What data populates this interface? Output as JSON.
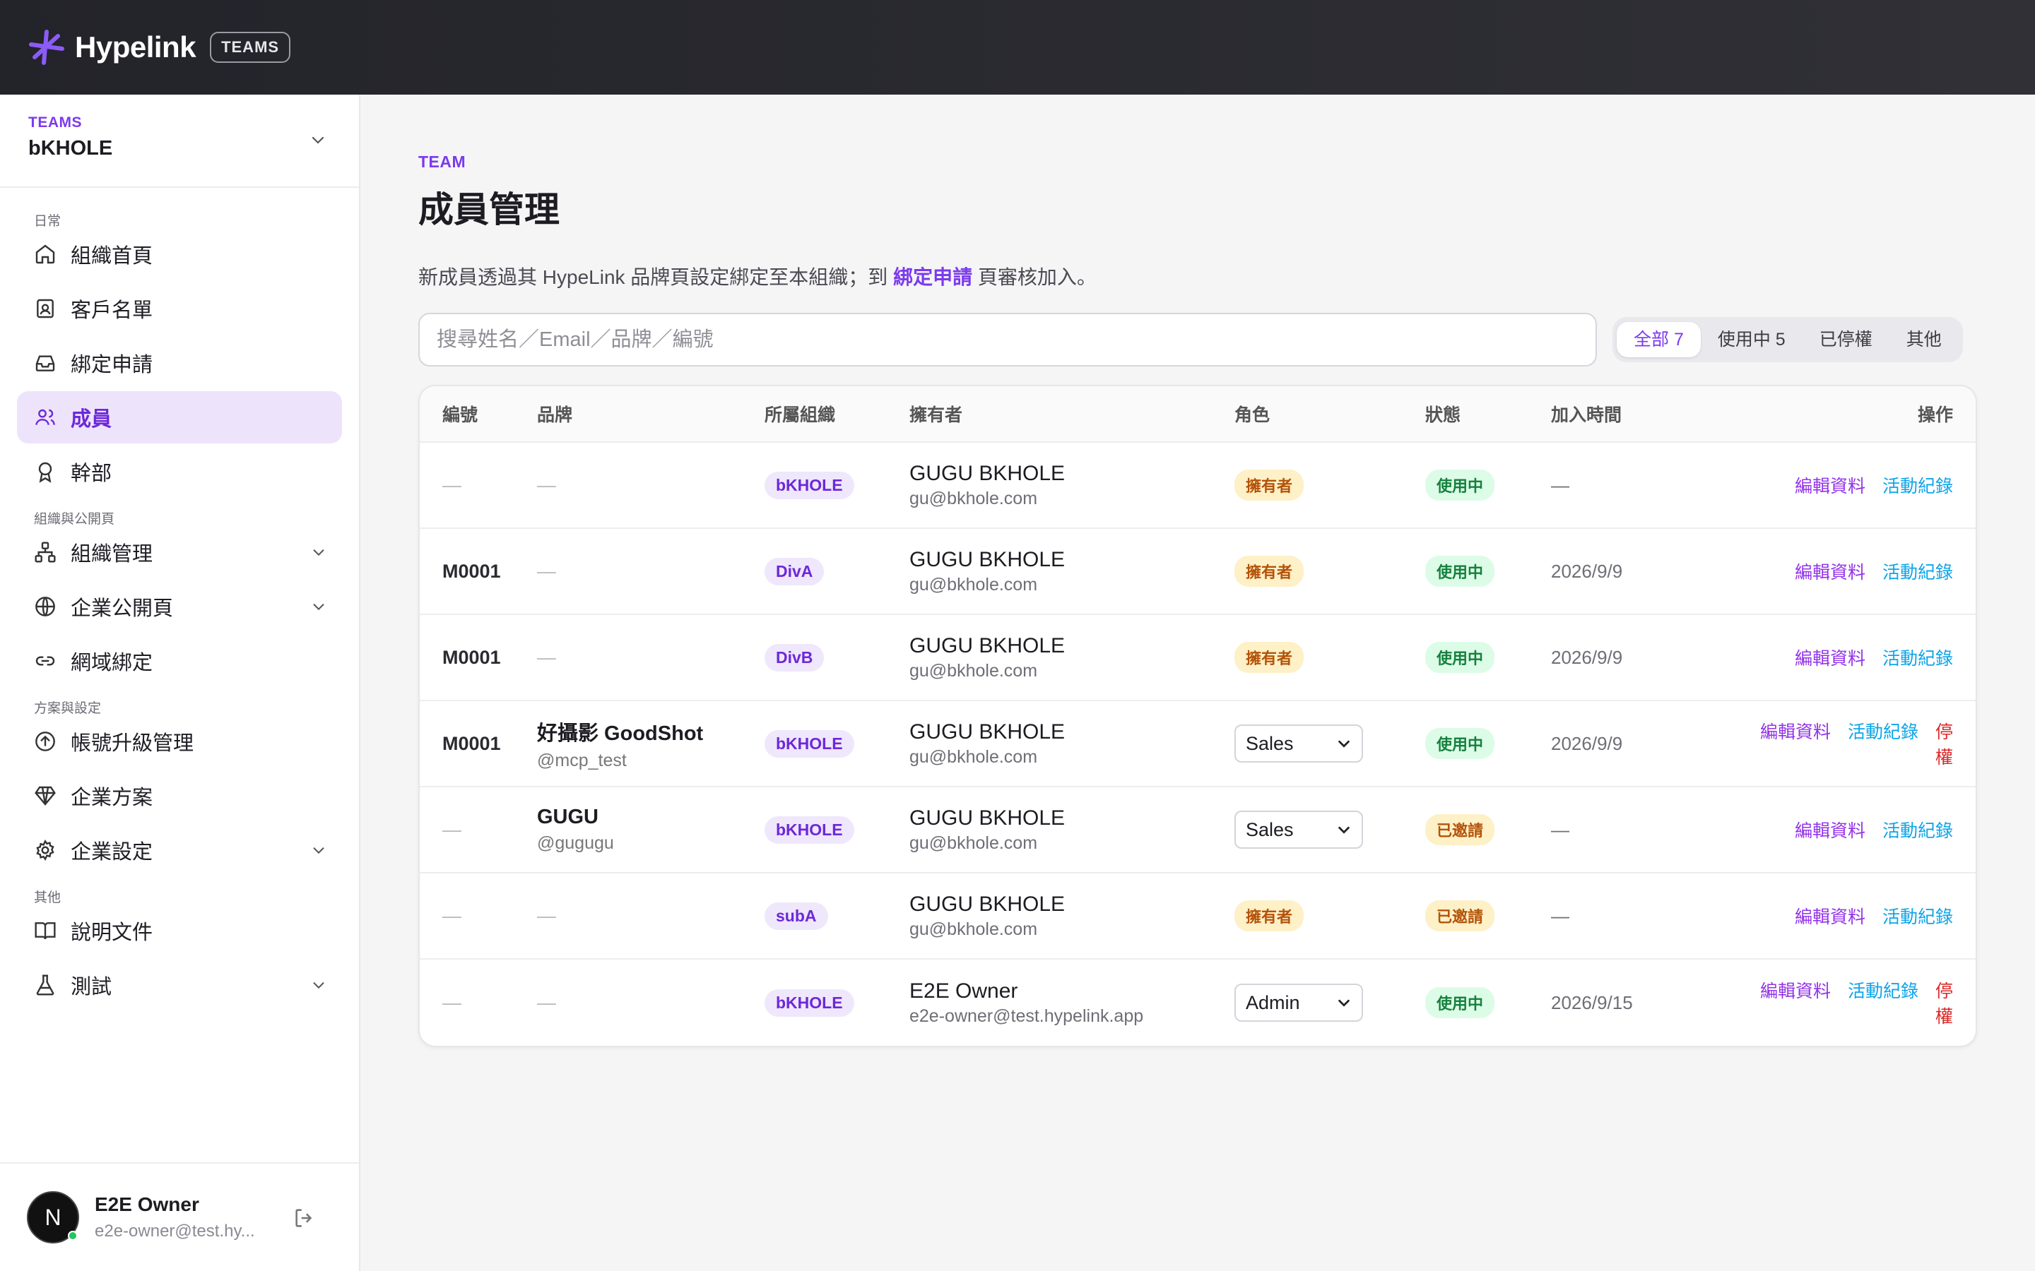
{
  "topbar": {
    "brand": "Hypelink",
    "badge": "TEAMS"
  },
  "sidebar": {
    "team_caption": "TEAMS",
    "team_name": "bKHOLE",
    "sections": {
      "daily": "日常",
      "org_public": "組織與公開頁",
      "plan_settings": "方案與設定",
      "other": "其他"
    },
    "items": {
      "home": "組織首頁",
      "customers": "客戶名單",
      "binding": "綁定申請",
      "members": "成員",
      "officers": "幹部",
      "org_manage": "組織管理",
      "public_page": "企業公開頁",
      "domain": "網域綁定",
      "upgrade": "帳號升級管理",
      "plan": "企業方案",
      "settings": "企業設定",
      "docs": "說明文件",
      "test": "測試"
    },
    "user": {
      "initial": "N",
      "name": "E2E Owner",
      "email": "e2e-owner@test.hy..."
    }
  },
  "main": {
    "eyebrow": "TEAM",
    "title": "成員管理",
    "desc_prefix": "新成員透過其 HypeLink 品牌頁設定綁定至本組織；到 ",
    "desc_link": "綁定申請",
    "desc_suffix": " 頁審核加入。",
    "search_placeholder": "搜尋姓名／Email／品牌／編號",
    "filters": [
      "全部 7",
      "使用中 5",
      "已停權",
      "其他"
    ],
    "columns": [
      "編號",
      "品牌",
      "所屬組織",
      "擁有者",
      "角色",
      "狀態",
      "加入時間",
      "操作"
    ],
    "actions": {
      "edit": "編輯資料",
      "log": "活動紀錄",
      "suspend": "停權"
    },
    "rows": [
      {
        "code": "—",
        "brand": "—",
        "brand_handle": "",
        "org": "bKHOLE",
        "owner": "GUGU BKHOLE",
        "email": "gu@bkhole.com",
        "role": "擁有者",
        "status": "使用中",
        "joined": "—"
      },
      {
        "code": "M0001",
        "brand": "—",
        "brand_handle": "",
        "org": "DivA",
        "owner": "GUGU BKHOLE",
        "email": "gu@bkhole.com",
        "role": "擁有者",
        "status": "使用中",
        "joined": "2026/9/9"
      },
      {
        "code": "M0001",
        "brand": "—",
        "brand_handle": "",
        "org": "DivB",
        "owner": "GUGU BKHOLE",
        "email": "gu@bkhole.com",
        "role": "擁有者",
        "status": "使用中",
        "joined": "2026/9/9"
      },
      {
        "code": "M0001",
        "brand": "好攝影 GoodShot",
        "brand_handle": "@mcp_test",
        "org": "bKHOLE",
        "owner": "GUGU BKHOLE",
        "email": "gu@bkhole.com",
        "role": "Sales",
        "status": "使用中",
        "joined": "2026/9/9"
      },
      {
        "code": "—",
        "brand": "GUGU",
        "brand_handle": "@gugugu",
        "org": "bKHOLE",
        "owner": "GUGU BKHOLE",
        "email": "gu@bkhole.com",
        "role": "Sales",
        "status": "已邀請",
        "joined": "—"
      },
      {
        "code": "—",
        "brand": "—",
        "brand_handle": "",
        "org": "subA",
        "owner": "GUGU BKHOLE",
        "email": "gu@bkhole.com",
        "role": "擁有者",
        "status": "已邀請",
        "joined": "—"
      },
      {
        "code": "—",
        "brand": "—",
        "brand_handle": "",
        "org": "bKHOLE",
        "owner": "E2E Owner",
        "email": "e2e-owner@test.hypelink.app",
        "role": "Admin",
        "status": "使用中",
        "joined": "2026/9/15"
      }
    ]
  },
  "colors": {
    "accent": "#7c3aed",
    "active_bg": "#ede4fb",
    "log_link": "#0ea5e9",
    "danger": "#dc2626"
  }
}
